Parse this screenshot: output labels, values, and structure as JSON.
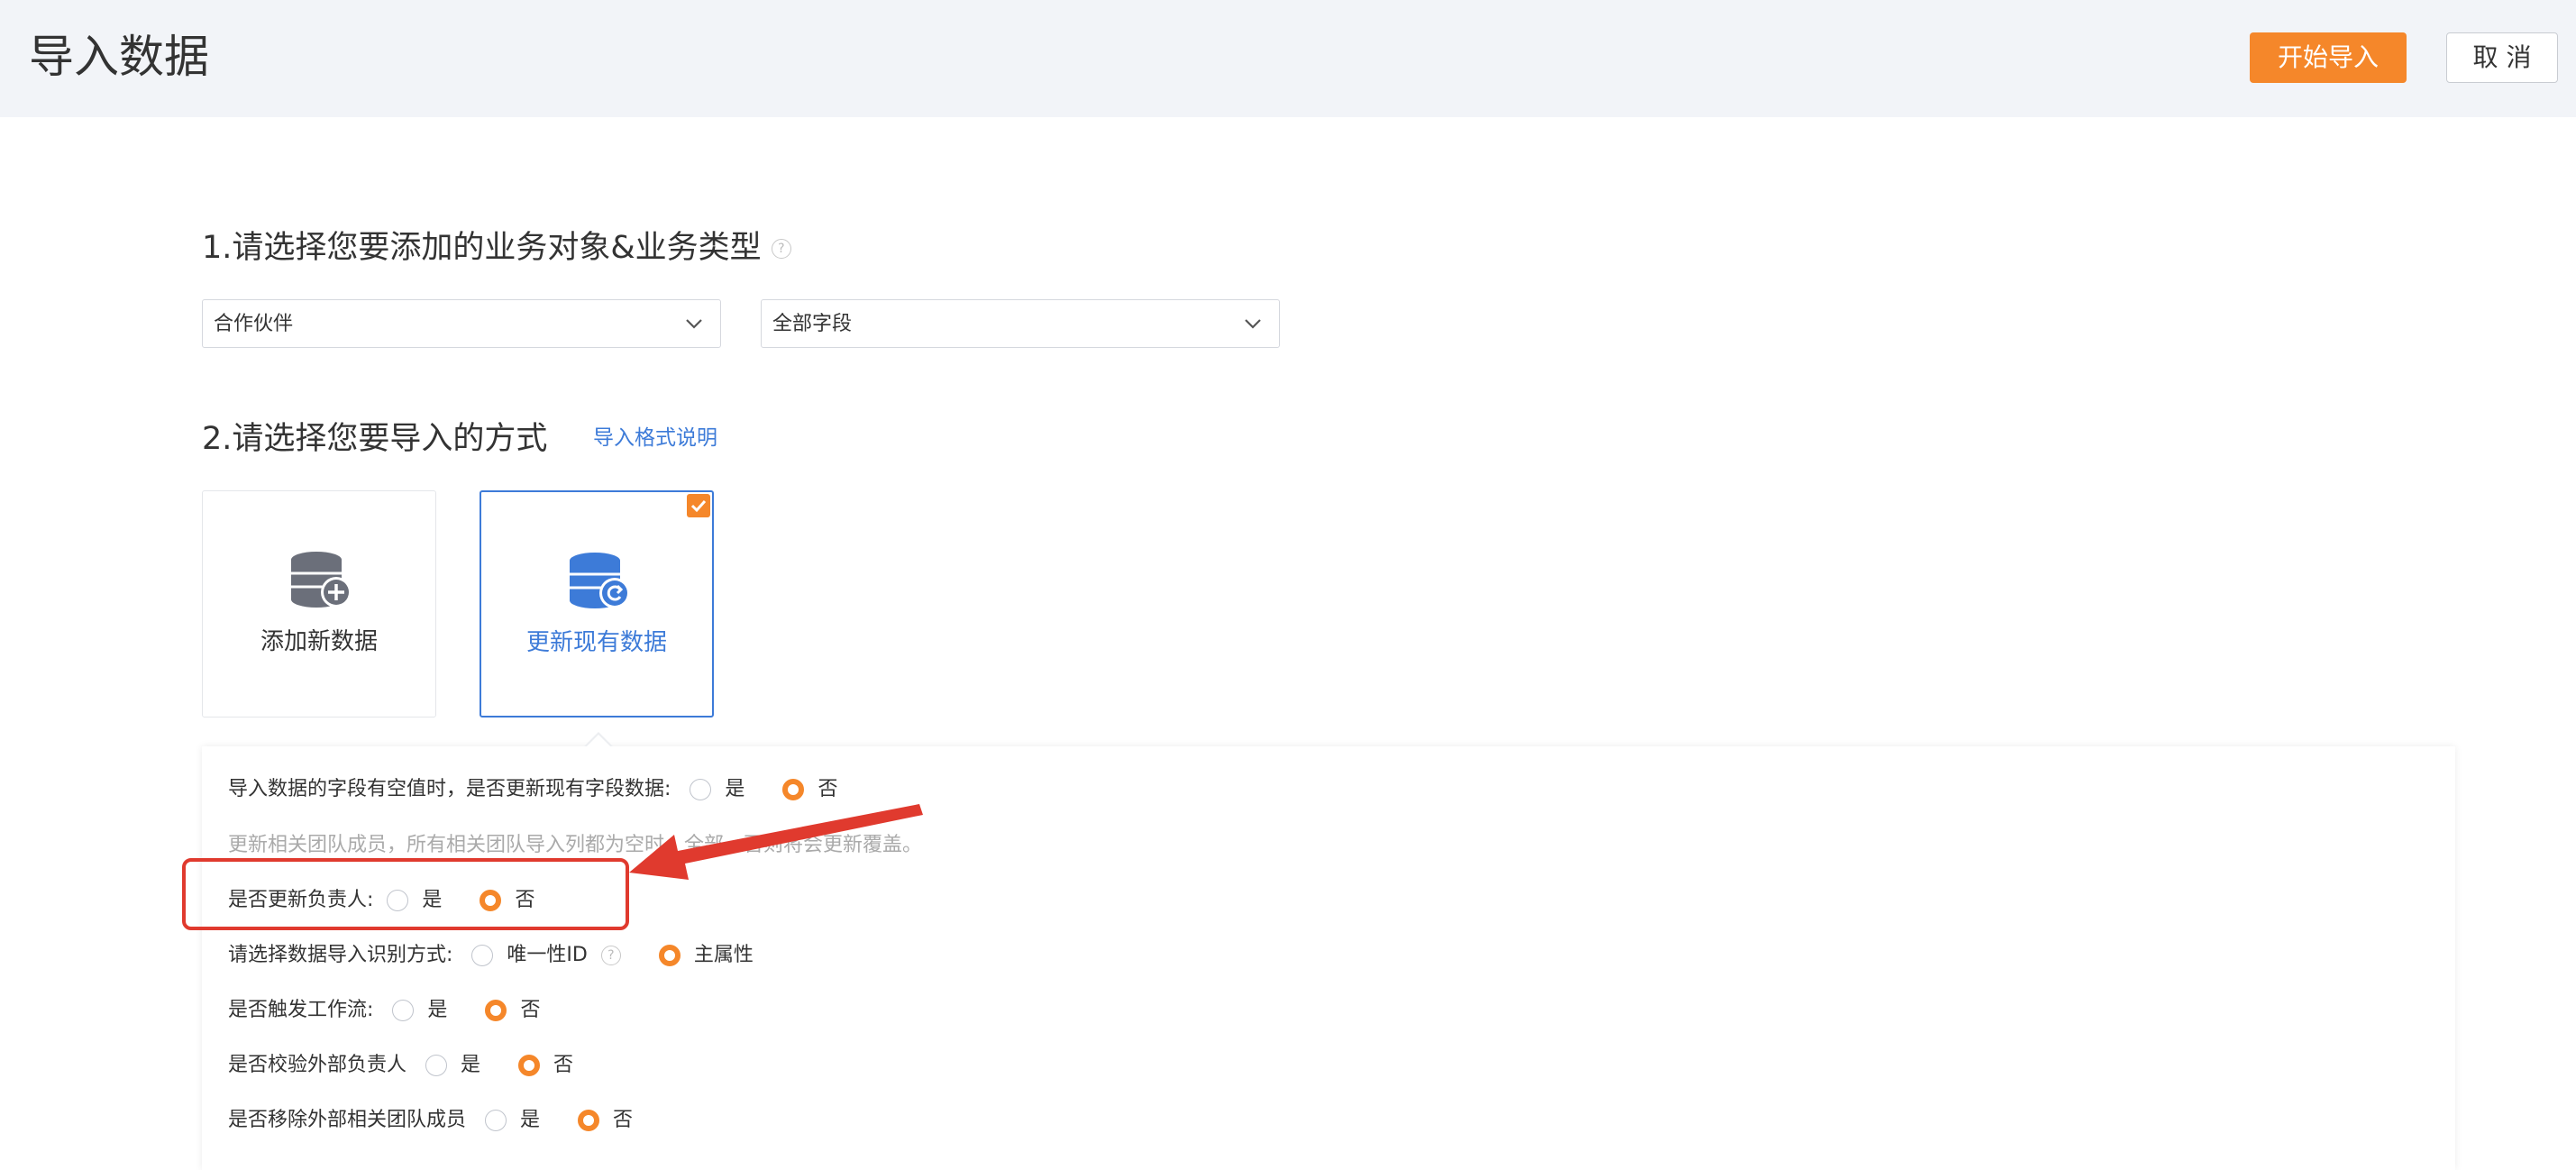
{
  "header": {
    "title": "导入数据",
    "start_button": "开始导入",
    "cancel_button": "取 消"
  },
  "section1": {
    "title": "1.请选择您要添加的业务对象&业务类型",
    "help_icon": "question-circle-icon",
    "object_select": {
      "value": "合作伙伴"
    },
    "type_select": {
      "value": "全部字段"
    }
  },
  "section2": {
    "title": "2.请选择您要导入的方式",
    "format_link": "导入格式说明",
    "cards": [
      {
        "label": "添加新数据",
        "icon": "database-add-icon",
        "selected": false
      },
      {
        "label": "更新现有数据",
        "icon": "database-refresh-icon",
        "selected": true
      }
    ]
  },
  "options": {
    "empty_update": {
      "label": "导入数据的字段有空值时，是否更新现有字段数据:",
      "yes": "是",
      "no": "否",
      "selected": "否"
    },
    "hint": "更新相关团队成员，所有相关团队导入列都为空时，全部…否则将会更新覆盖。",
    "update_owner": {
      "label": "是否更新负责人:",
      "yes": "是",
      "no": "否",
      "selected": "否"
    },
    "identify_method": {
      "label": "请选择数据导入识别方式:",
      "opt1": "唯一性ID",
      "opt2": "主属性",
      "selected": "主属性"
    },
    "trigger_workflow": {
      "label": "是否触发工作流:",
      "yes": "是",
      "no": "否",
      "selected": "否"
    },
    "validate_external_owner": {
      "label": "是否校验外部负责人",
      "yes": "是",
      "no": "否",
      "selected": "否"
    },
    "remove_external_team": {
      "label": "是否移除外部相关团队成员",
      "yes": "是",
      "no": "否",
      "selected": "否"
    }
  },
  "colors": {
    "accent_orange": "#f5872a",
    "link_blue": "#3d7bd8",
    "annotation_red": "#e03a2e"
  }
}
